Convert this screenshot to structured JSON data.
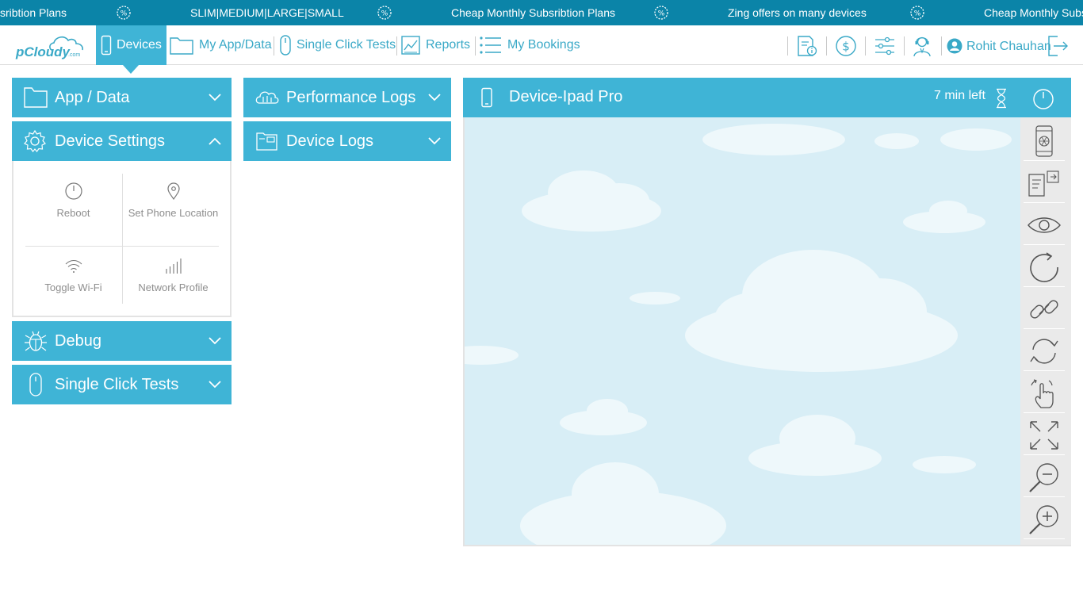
{
  "ticker": {
    "items": [
      "sribtion Plans",
      "SLIM|MEDIUM|LARGE|SMALL",
      "Cheap Monthly Subsribtion Plans",
      "Zing offers on many devices",
      "Cheap Monthly Subsrib"
    ]
  },
  "header": {
    "logo_text": "pCloudy",
    "logo_suffix": ".com",
    "nav": {
      "devices": "Devices",
      "my_app_data": "My App/Data",
      "single_click_tests": "Single Click Tests",
      "reports": "Reports",
      "my_bookings": "My Bookings"
    },
    "user_name": "Rohit Chauhan"
  },
  "left_panels": {
    "app_data": "App / Data",
    "device_settings": "Device Settings",
    "debug": "Debug",
    "single_click_tests": "Single Click Tests"
  },
  "device_settings": {
    "reboot": "Reboot",
    "set_phone_location": "Set Phone Location",
    "toggle_wifi": "Toggle Wi-Fi",
    "network_profile": "Network Profile"
  },
  "mid_panels": {
    "performance_logs": "Performance Logs",
    "device_logs": "Device Logs"
  },
  "device": {
    "title": "Device-Ipad Pro",
    "time_left": "7 min left"
  },
  "colors": {
    "ticker_bg": "#0b84a8",
    "accent": "#3fb4d6",
    "text_accent": "#3aa9c7",
    "screen_bg": "#d8eef6"
  },
  "icons": {
    "toolbar": [
      "screenshot-icon",
      "install-app-icon",
      "view-icon",
      "reload-icon",
      "link-icon",
      "rotate-icon",
      "gesture-icon",
      "fullscreen-icon",
      "zoom-out-icon",
      "zoom-in-icon"
    ]
  }
}
